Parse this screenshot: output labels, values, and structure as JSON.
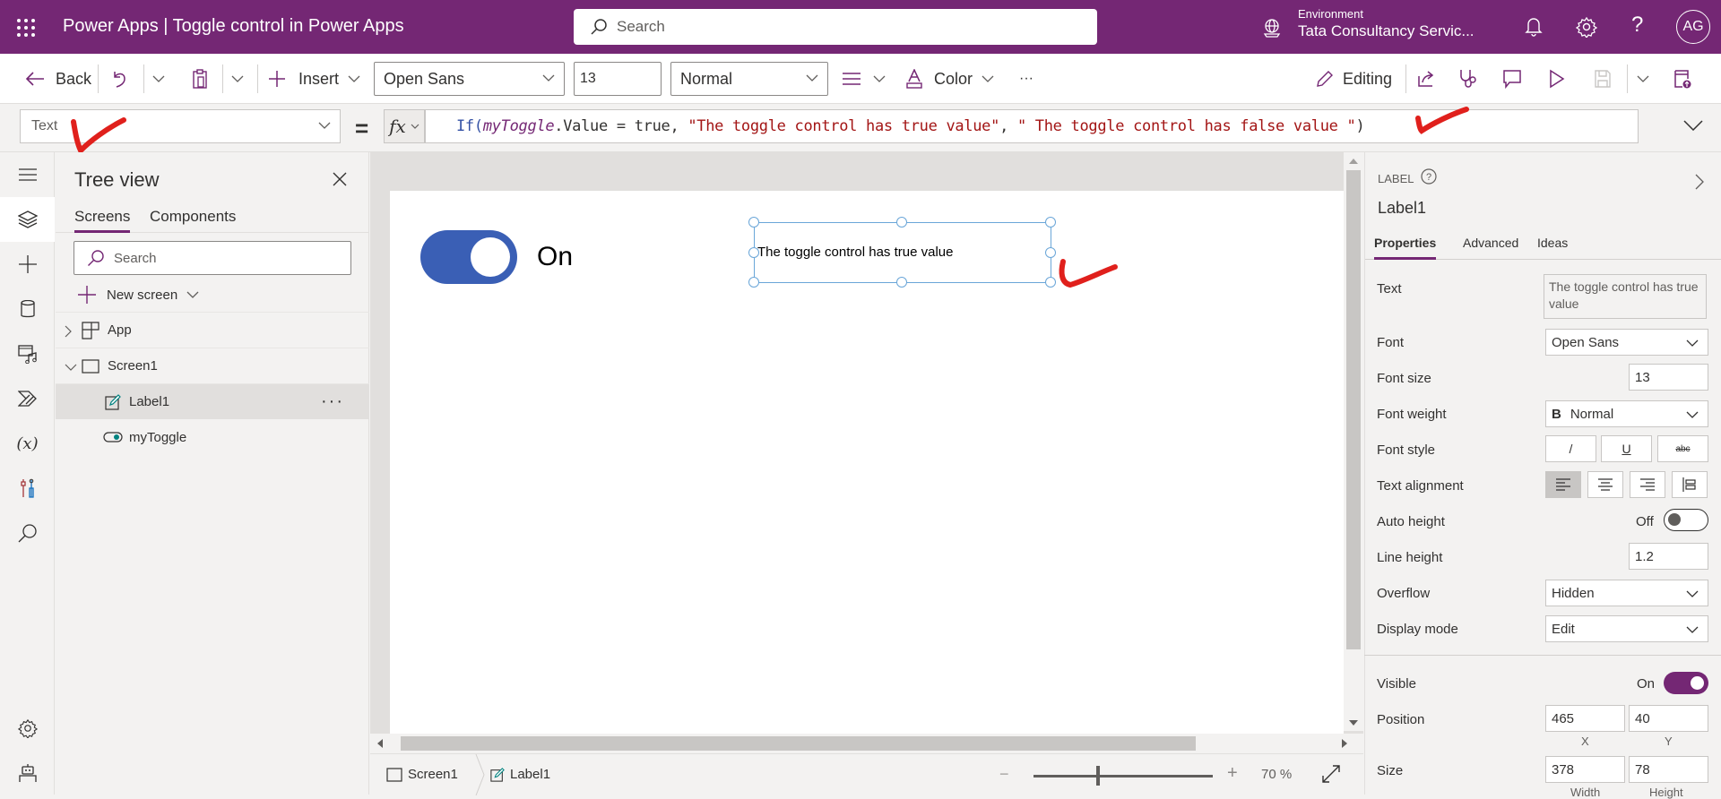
{
  "header": {
    "app_title": "Power Apps  |  Toggle control in Power Apps",
    "search_placeholder": "Search",
    "environment_label": "Environment",
    "environment_value": "Tata Consultancy Servic...",
    "avatar_initials": "AG",
    "brand_color": "#742774"
  },
  "toolbar": {
    "back_label": "Back",
    "insert_label": "Insert",
    "font_value": "Open Sans",
    "font_size_value": "13",
    "font_weight_value": "Normal",
    "color_label": "Color",
    "more_label": "···",
    "editing_label": "Editing"
  },
  "formula_bar": {
    "property": "Text",
    "equals": "=",
    "fx_label": "fx",
    "formula_tokens": {
      "fn": "If(",
      "id": "myToggle",
      "mid": ".Value = true, ",
      "str1": "\"The toggle control has true value\"",
      "comma": ", ",
      "str2": "\" The toggle control has false value \"",
      "close": ")"
    }
  },
  "tree_view": {
    "title": "Tree view",
    "tabs": [
      "Screens",
      "Components"
    ],
    "search_placeholder": "Search",
    "new_screen_label": "New screen",
    "items": [
      {
        "label": "App"
      },
      {
        "label": "Screen1"
      },
      {
        "label": "Label1"
      },
      {
        "label": "myToggle"
      }
    ],
    "more_label": "···"
  },
  "canvas": {
    "toggle_state_label": "On",
    "label_text": "The toggle control has true value",
    "toggle_color": "#3a5fb5"
  },
  "status_bar": {
    "breadcrumb": [
      "Screen1",
      "Label1"
    ],
    "zoom_minus": "−",
    "zoom_plus": "+",
    "zoom_value": "70  %",
    "zoom_percent": 70
  },
  "properties": {
    "control_type": "LABEL",
    "control_name": "Label1",
    "tabs": [
      "Properties",
      "Advanced",
      "Ideas"
    ],
    "rows": {
      "text_label": "Text",
      "text_value": "The toggle control has true value",
      "font_label": "Font",
      "font_value": "Open Sans",
      "font_size_label": "Font size",
      "font_size_value": "13",
      "font_weight_label": "Font weight",
      "font_weight_icon": "B",
      "font_weight_value": "Normal",
      "font_style_label": "Font style",
      "font_style_italic": "/",
      "font_style_underline": "U",
      "font_style_strike": "abc",
      "text_alignment_label": "Text alignment",
      "auto_height_label": "Auto height",
      "auto_height_state": "Off",
      "line_height_label": "Line height",
      "line_height_value": "1.2",
      "overflow_label": "Overflow",
      "overflow_value": "Hidden",
      "display_mode_label": "Display mode",
      "display_mode_value": "Edit",
      "visible_label": "Visible",
      "visible_state": "On",
      "position_label": "Position",
      "position_x": "465",
      "position_y": "40",
      "x_caption": "X",
      "y_caption": "Y",
      "size_label": "Size",
      "size_width": "378",
      "size_height": "78",
      "width_caption": "Width",
      "height_caption": "Height"
    }
  }
}
